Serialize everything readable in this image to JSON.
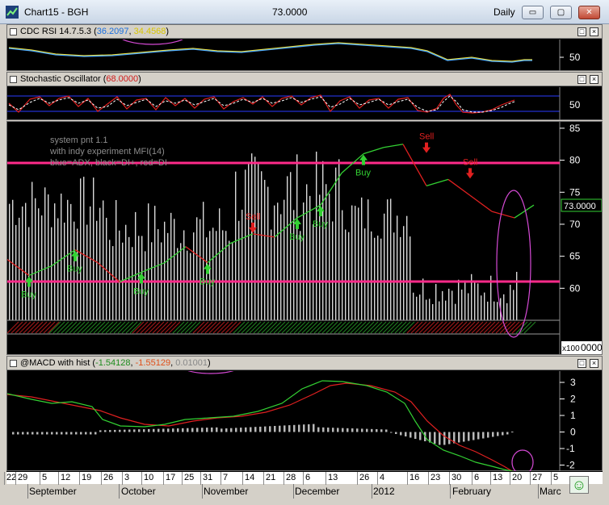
{
  "window": {
    "title": "Chart15 - BGH",
    "last_price": "73.0000",
    "period": "Daily",
    "minimize_glyph": "▭",
    "restore_glyph": "▢",
    "close_glyph": "✕"
  },
  "panes": {
    "rsi": {
      "title_prefix": "CDC RSI 14.7.5.3 (",
      "value1": "36.2097",
      "value2": "34.4568",
      "title_suffix": ")",
      "axis_labels": [
        "50"
      ]
    },
    "stochastic": {
      "title_prefix": "Stochastic Oscillator (",
      "value": "68.0000",
      "title_suffix": ")",
      "axis_labels": [
        "50"
      ]
    },
    "price": {
      "annotations": [
        "system pnt 1.1",
        "with indy experiment MFI(14)",
        "blue=ADX, black=DI+, red=DI-"
      ],
      "axis_labels": [
        "85",
        "80",
        "75",
        "70",
        "65",
        "60"
      ],
      "price_tag": "73.0000",
      "volume_scale": "x100",
      "volume_zero": "0000",
      "buy_label": "Buy",
      "sell_label": "Sell"
    },
    "macd": {
      "title_prefix": "@MACD with hist (",
      "value1": "-1.54128",
      "value2": "-1.55129",
      "value3": "0.01001",
      "title_suffix": ")",
      "axis_labels": [
        "3",
        "2",
        "1",
        "0",
        "-1",
        "-2"
      ]
    }
  },
  "x_axis": {
    "days": [
      "22",
      "29",
      "5",
      "12",
      "19",
      "26",
      "3",
      "10",
      "17",
      "25",
      "31",
      "7",
      "14",
      "21",
      "28",
      "6",
      "13",
      "26",
      "4",
      "16",
      "23",
      "30",
      "6",
      "13",
      "20",
      "27",
      "5"
    ],
    "months": [
      "September",
      "October",
      "November",
      "December",
      "2012",
      "February",
      "Marc"
    ]
  },
  "colors": {
    "rsi_line1": "#4aa8ff",
    "rsi_line2": "#f2e23a",
    "price_up": "#33d133",
    "price_down": "#e02020",
    "level_line": "#ff2a8a",
    "annotation_circle": "#d64ad6"
  },
  "chart_data": {
    "type": "line",
    "title": "",
    "x": [
      "22",
      "29",
      "5",
      "12",
      "19",
      "26",
      "3",
      "10",
      "17",
      "25",
      "31",
      "7",
      "14",
      "21",
      "28",
      "6",
      "13",
      "26",
      "4",
      "16",
      "23",
      "30",
      "6",
      "13",
      "20"
    ],
    "series": [
      {
        "values": [
          64.5,
          62,
          63.5,
          66,
          64,
          61,
          62.5,
          64,
          66.5,
          64,
          67,
          68.5,
          68,
          71,
          73,
          78,
          81,
          82,
          82.5,
          76,
          77,
          74.5,
          72,
          71,
          73
        ]
      }
    ],
    "ylim": [
      55,
      86
    ],
    "signals": [
      {
        "label": "Buy",
        "x": "29",
        "price": 62
      },
      {
        "label": "Buy",
        "x": "12",
        "price": 66
      },
      {
        "label": "Buy",
        "x": "3",
        "price": 62.5
      },
      {
        "label": "Buy",
        "x": "25",
        "price": 64
      },
      {
        "label": "Sell",
        "x": "7",
        "price": 68.5
      },
      {
        "label": "Buy",
        "x": "21",
        "price": 71
      },
      {
        "label": "Buy",
        "x": "28",
        "price": 73
      },
      {
        "label": "Buy",
        "x": "13",
        "price": 81
      },
      {
        "label": "Sell",
        "x": "16",
        "price": 81
      },
      {
        "label": "Sell",
        "x": "30",
        "price": 77
      }
    ],
    "reference_lines": [
      80,
      61
    ]
  }
}
